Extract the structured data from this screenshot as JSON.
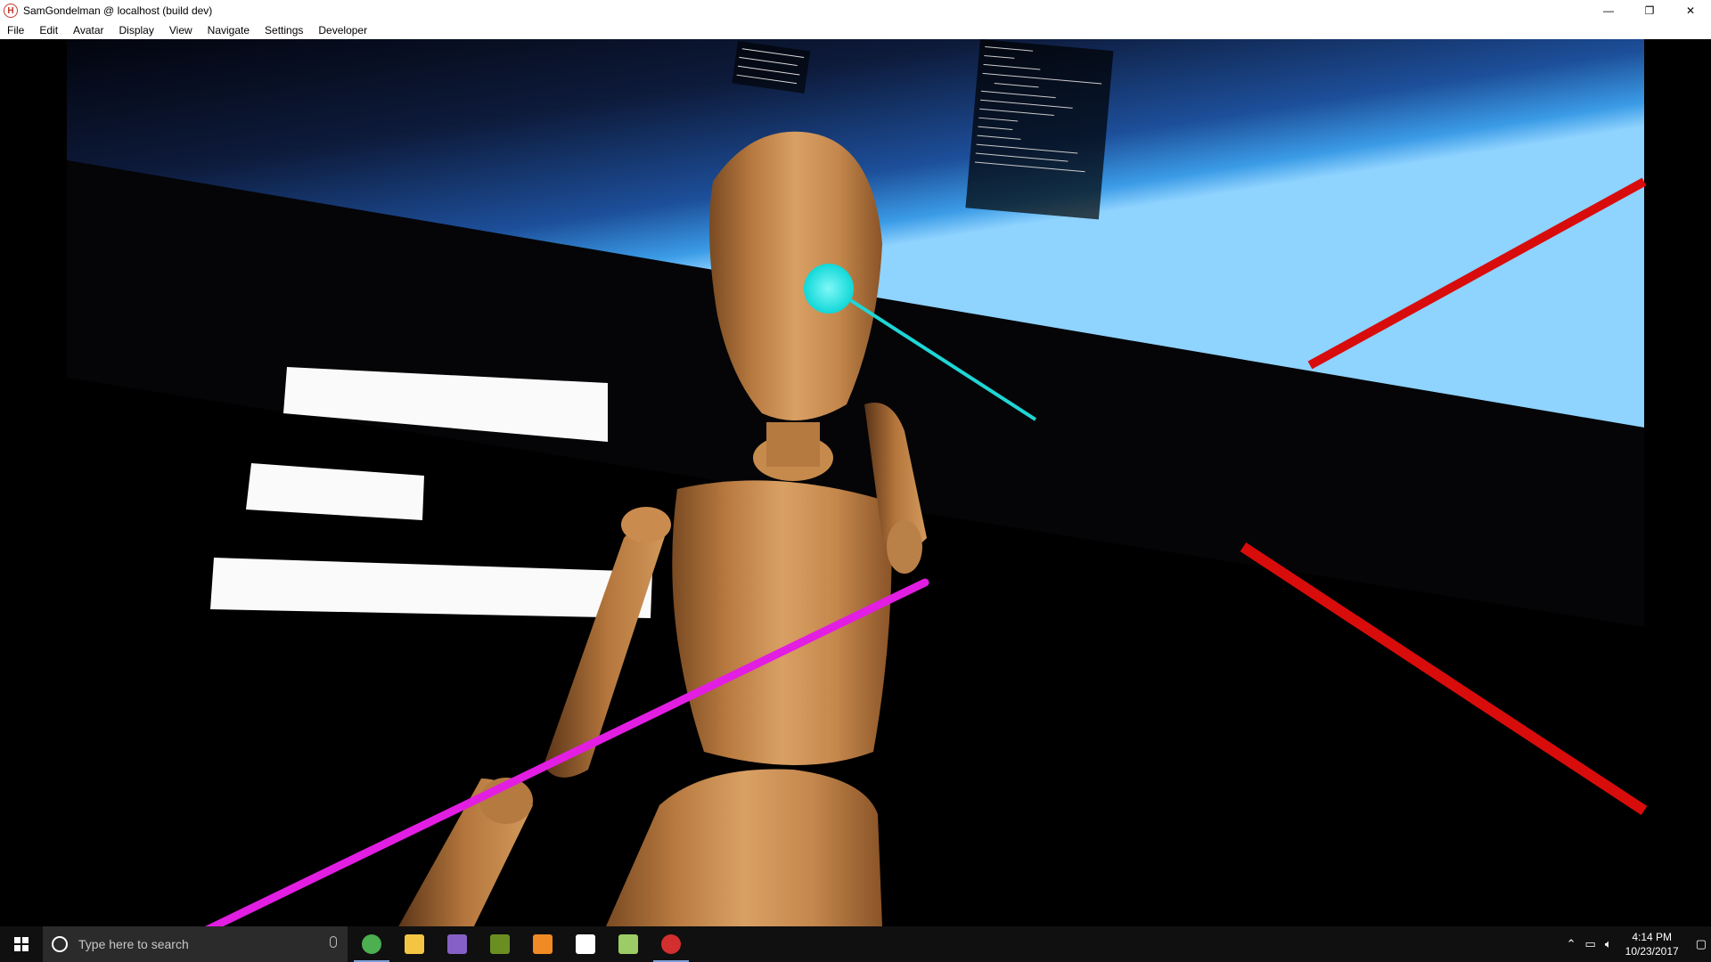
{
  "window": {
    "title": "SamGondelman @ localhost (build dev)",
    "app_icon": "H",
    "controls": [
      "—",
      "❐",
      "✕"
    ]
  },
  "menu": [
    "File",
    "Edit",
    "Avatar",
    "Display",
    "View",
    "Navigate",
    "Settings",
    "Developer"
  ],
  "taskbar": {
    "search_placeholder": "Type here to search",
    "apps": [
      {
        "icon": "chrome-icon",
        "color": "#4caf50"
      },
      {
        "icon": "file-explorer-icon",
        "color": "#f4c542"
      },
      {
        "icon": "visual-studio-icon",
        "color": "#8661c5"
      },
      {
        "icon": "git-icon",
        "color": "#6b8e23"
      },
      {
        "icon": "sublime-text-icon",
        "color": "#f08a24"
      },
      {
        "icon": "oculus-icon",
        "color": "#ffffff"
      },
      {
        "icon": "paint-icon",
        "color": "#9ccc65"
      },
      {
        "icon": "high-fidelity-icon",
        "color": "#d32f2f"
      }
    ],
    "clock_time": "4:14 PM",
    "clock_date": "10/23/2017"
  },
  "scene": {
    "colors": {
      "sky_top": "#0b0f26",
      "horizon_glow": "#2f8fe0",
      "wood": "#c8884a",
      "cyan_pointer": "#1ee0e0",
      "magenta_laser": "#e020e0",
      "red_laser": "#e01010"
    }
  }
}
